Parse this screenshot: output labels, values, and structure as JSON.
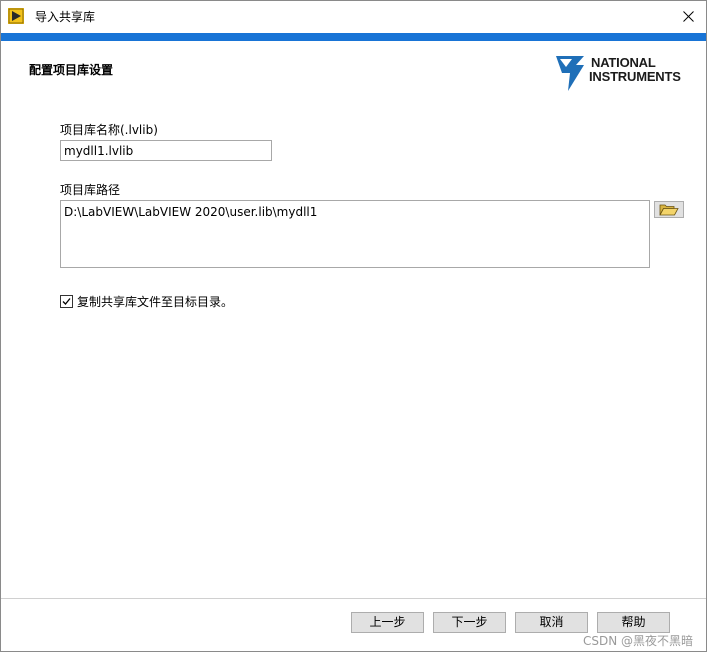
{
  "window": {
    "title": "导入共享库",
    "close_symbol": "✕"
  },
  "header": {
    "section_title": "配置项目库设置",
    "logo_line1": "NATIONAL",
    "logo_line2": "INSTRUMENTS",
    "logo_mark": "®"
  },
  "form": {
    "library_name_label": "项目库名称(.lvlib)",
    "library_name_value": "mydll1.lvlib",
    "library_path_label": "项目库路径",
    "library_path_value": "D:\\LabVIEW\\LabVIEW 2020\\user.lib\\mydll1",
    "copy_checkbox_label": "复制共享库文件至目标目录。",
    "copy_checkbox_checked": true,
    "browse_icon": "folder-open-icon"
  },
  "footer": {
    "back_label": "上一步",
    "next_label": "下一步",
    "cancel_label": "取消",
    "help_label": "帮助"
  },
  "watermark": "CSDN @黑夜不黑暗",
  "colors": {
    "accent_band": "#1874d6",
    "logo_blue": "#1f6fb8",
    "button_bg": "#e1e1e1"
  }
}
